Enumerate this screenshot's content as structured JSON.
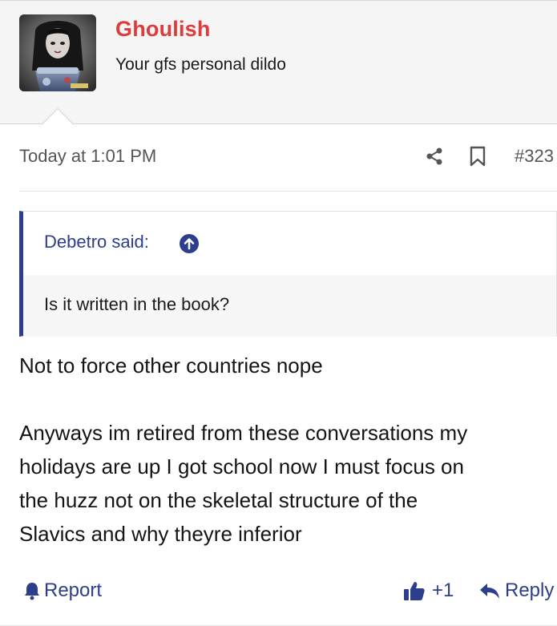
{
  "user": {
    "name": "Ghoulish",
    "title": "Your gfs personal dildo",
    "avatar_icon": "avatar-photo"
  },
  "meta": {
    "date": "Today at 1:01 PM",
    "share_icon": "share-icon",
    "bookmark_icon": "bookmark-icon",
    "post_number": "#323"
  },
  "quote": {
    "author_label": "Debetro said:",
    "arrow_icon": "arrow-up-circle-icon",
    "text": "Is it written in the book?"
  },
  "message": {
    "paragraph1": "Not to force other countries nope",
    "paragraph2_lines": [
      "Anyways im retired from these conversations my",
      "holidays are up I got school now I must focus on",
      "the huzz not on the skeletal structure of the",
      "Slavics and why theyre inferior"
    ]
  },
  "footer": {
    "report_label": "Report",
    "like_count": "+1",
    "reply_label": "Reply"
  },
  "colors": {
    "username": "#e03b3b",
    "accent": "#2d3e8c",
    "header_bg": "#f5f5f5",
    "meta_text": "#555555"
  }
}
